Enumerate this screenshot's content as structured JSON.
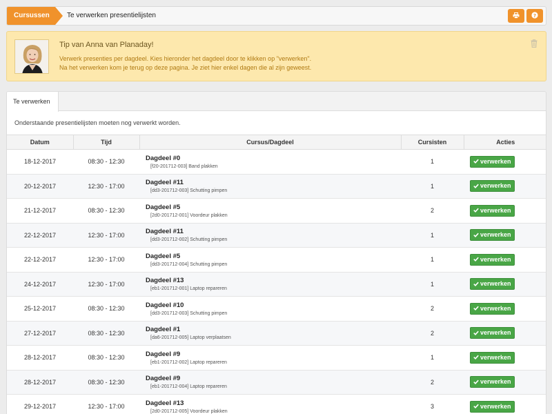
{
  "header": {
    "breadcrumb": "Cursussen",
    "title": "Te verwerken presentielijsten",
    "print_icon": "print-icon",
    "help_icon": "question-icon"
  },
  "tip": {
    "title": "Tip van Anna van Planaday!",
    "line1": "Verwerk presenties per dagdeel. Kies hieronder het dagdeel door te klikken op \"verwerken\".",
    "line2": "Na het verwerken kom je terug op deze pagina. Je ziet hier enkel dagen die al zijn geweest.",
    "dismiss_icon": "trash-icon"
  },
  "tabs": [
    {
      "label": "Te verwerken"
    }
  ],
  "intro": "Onderstaande presentielijsten moeten nog verwerkt worden.",
  "columns": [
    "Datum",
    "Tijd",
    "Cursus/Dagdeel",
    "Cursisten",
    "Acties"
  ],
  "action_label": "verwerken",
  "colors": {
    "accent": "#f0922b",
    "success": "#49a646",
    "tip_bg": "#fde8ad"
  },
  "rows": [
    {
      "date": "18-12-2017",
      "time": "08:30 - 12:30",
      "dagdeel": "Dagdeel #0",
      "course": "[f20-201712-003] Band plakken",
      "students": "1"
    },
    {
      "date": "20-12-2017",
      "time": "12:30 - 17:00",
      "dagdeel": "Dagdeel #11",
      "course": "[dd3-201712-003] Schutting pimpen",
      "students": "1"
    },
    {
      "date": "21-12-2017",
      "time": "08:30 - 12:30",
      "dagdeel": "Dagdeel #5",
      "course": "[2d0-201712-001] Voordeur plakken",
      "students": "2"
    },
    {
      "date": "22-12-2017",
      "time": "12:30 - 17:00",
      "dagdeel": "Dagdeel #11",
      "course": "[dd3-201712-002] Schutting pimpen",
      "students": "1"
    },
    {
      "date": "22-12-2017",
      "time": "12:30 - 17:00",
      "dagdeel": "Dagdeel #5",
      "course": "[dd3-201712-004] Schutting pimpen",
      "students": "1"
    },
    {
      "date": "24-12-2017",
      "time": "12:30 - 17:00",
      "dagdeel": "Dagdeel #13",
      "course": "[eb1-201712-001] Laptop repareren",
      "students": "1"
    },
    {
      "date": "25-12-2017",
      "time": "08:30 - 12:30",
      "dagdeel": "Dagdeel #10",
      "course": "[dd3-201712-003] Schutting pimpen",
      "students": "2"
    },
    {
      "date": "27-12-2017",
      "time": "08:30 - 12:30",
      "dagdeel": "Dagdeel #1",
      "course": "[da6-201712-005] Laptop verplaatsen",
      "students": "2"
    },
    {
      "date": "28-12-2017",
      "time": "08:30 - 12:30",
      "dagdeel": "Dagdeel #9",
      "course": "[eb1-201712-002] Laptop repareren",
      "students": "1"
    },
    {
      "date": "28-12-2017",
      "time": "08:30 - 12:30",
      "dagdeel": "Dagdeel #9",
      "course": "[eb1-201712-004] Laptop repareren",
      "students": "2"
    },
    {
      "date": "29-12-2017",
      "time": "12:30 - 17:00",
      "dagdeel": "Dagdeel #13",
      "course": "[2d0-201712-005] Voordeur plakken",
      "students": "3"
    }
  ]
}
